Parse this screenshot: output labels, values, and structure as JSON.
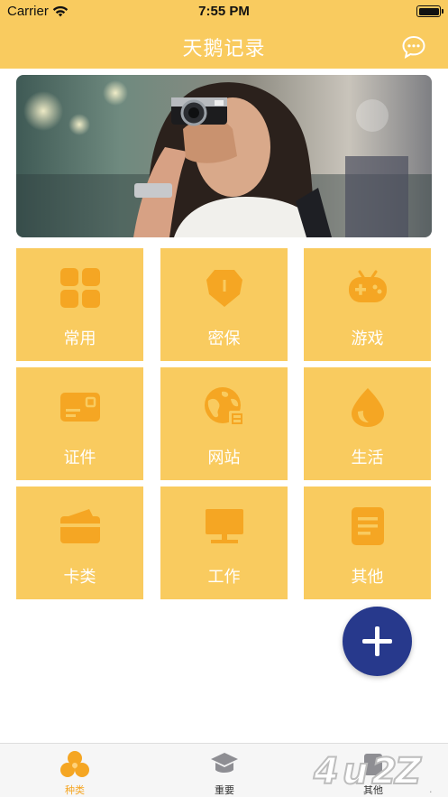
{
  "status_bar": {
    "carrier": "Carrier",
    "time": "7:55 PM"
  },
  "nav": {
    "title": "天鹅记录",
    "chat_icon": "chat-bubble-icon"
  },
  "banner": {
    "image": "woman-with-camera-photo"
  },
  "categories": [
    {
      "label": "常用",
      "icon": "grid-icon"
    },
    {
      "label": "密保",
      "icon": "shield-icon"
    },
    {
      "label": "游戏",
      "icon": "gamepad-icon"
    },
    {
      "label": "证件",
      "icon": "id-card-icon"
    },
    {
      "label": "网站",
      "icon": "globe-icon"
    },
    {
      "label": "生活",
      "icon": "water-drop-icon"
    },
    {
      "label": "卡类",
      "icon": "wallet-card-icon"
    },
    {
      "label": "工作",
      "icon": "monitor-icon"
    },
    {
      "label": "其他",
      "icon": "document-icon"
    }
  ],
  "fab": {
    "icon": "plus-icon"
  },
  "tabs": [
    {
      "label": "种类",
      "icon": "category-icon",
      "active": true
    },
    {
      "label": "重要",
      "icon": "graduation-cap-icon",
      "active": false
    },
    {
      "label": "其他",
      "icon": "other-icon",
      "active": false
    }
  ],
  "watermark": {
    "text": "4u2"
  },
  "colors": {
    "accent": "#f9cb5f",
    "icon_orange": "#f5a623",
    "fab": "#27398c",
    "white": "#ffffff"
  }
}
